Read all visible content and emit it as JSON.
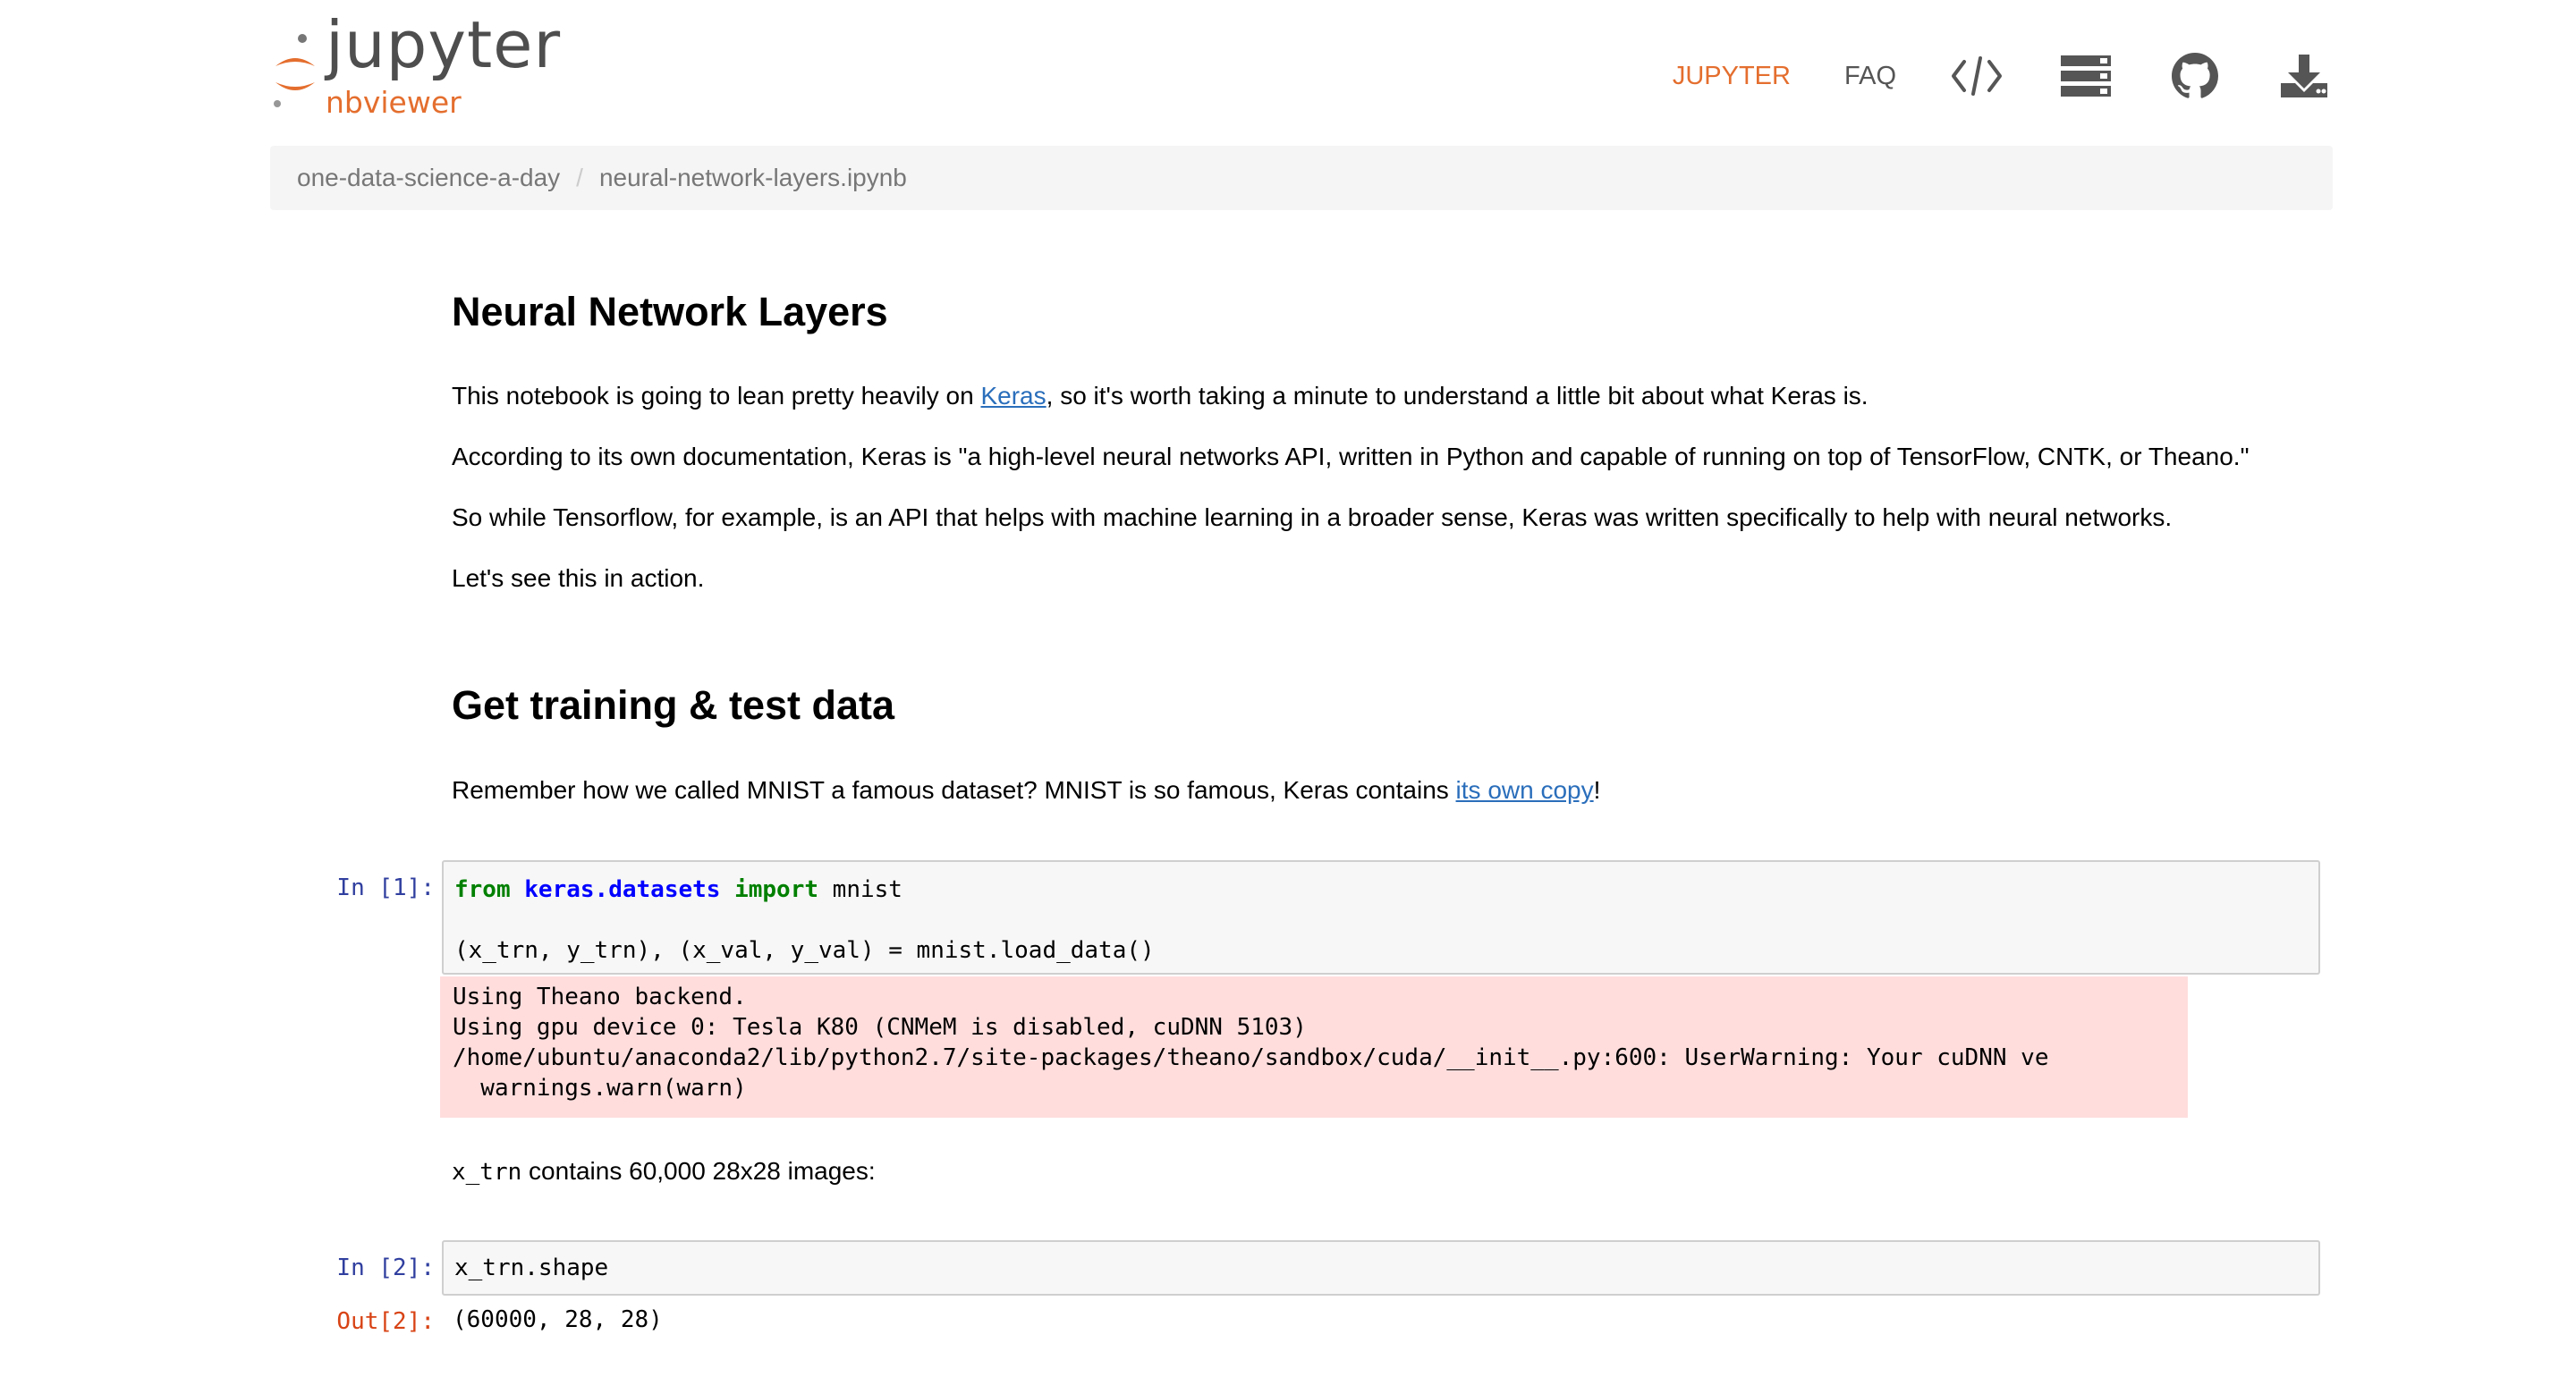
{
  "header": {
    "logo_word": "jupyter",
    "logo_sub": "nbviewer",
    "nav": {
      "jupyter_label": "JUPYTER",
      "faq_label": "FAQ"
    },
    "icons": [
      "code-icon",
      "server-icon",
      "github-icon",
      "download-icon"
    ],
    "colors": {
      "brand_orange": "#e46e2e",
      "nav_gray": "#555555"
    }
  },
  "breadcrumb": {
    "items": [
      "one-data-science-a-day",
      "neural-network-layers.ipynb"
    ],
    "separator": "/"
  },
  "notebook": {
    "section1": {
      "title": "Neural Network Layers",
      "p1_before": "This notebook is going to lean pretty heavily on ",
      "p1_link": "Keras",
      "p1_after": ", so it's worth taking a minute to understand a little bit about what Keras is.",
      "p2": "According to its own documentation, Keras is \"a high-level neural networks API, written in Python and capable of running on top of TensorFlow, CNTK, or Theano.\"",
      "p3": "So while Tensorflow, for example, is an API that helps with machine learning in a broader sense, Keras was written specifically to help with neural networks.",
      "p4": "Let's see this in action."
    },
    "section2": {
      "title": "Get training & test data",
      "p1_before": "Remember how we called MNIST a famous dataset? MNIST is so famous, Keras contains ",
      "p1_link": "its own copy",
      "p1_after": "!"
    },
    "cell1": {
      "prompt": "In [1]:",
      "code_line1_kw1": "from",
      "code_line1_mod": "keras.datasets",
      "code_line1_kw2": "import",
      "code_line1_name": "mnist",
      "code_line3": "(x_trn, y_trn), (x_val, y_val) = mnist.load_data()",
      "stderr": "Using Theano backend.\nUsing gpu device 0: Tesla K80 (CNMeM is disabled, cuDNN 5103)\n/home/ubuntu/anaconda2/lib/python2.7/site-packages/theano/sandbox/cuda/__init__.py:600: UserWarning: Your cuDNN ve\n  warnings.warn(warn)"
    },
    "md3": {
      "code": "x_trn",
      "text": " contains 60,000 28x28 images:"
    },
    "cell2": {
      "prompt_in": "In [2]:",
      "code": "x_trn.shape",
      "prompt_out": "Out[2]:",
      "output": "(60000, 28, 28)"
    }
  }
}
